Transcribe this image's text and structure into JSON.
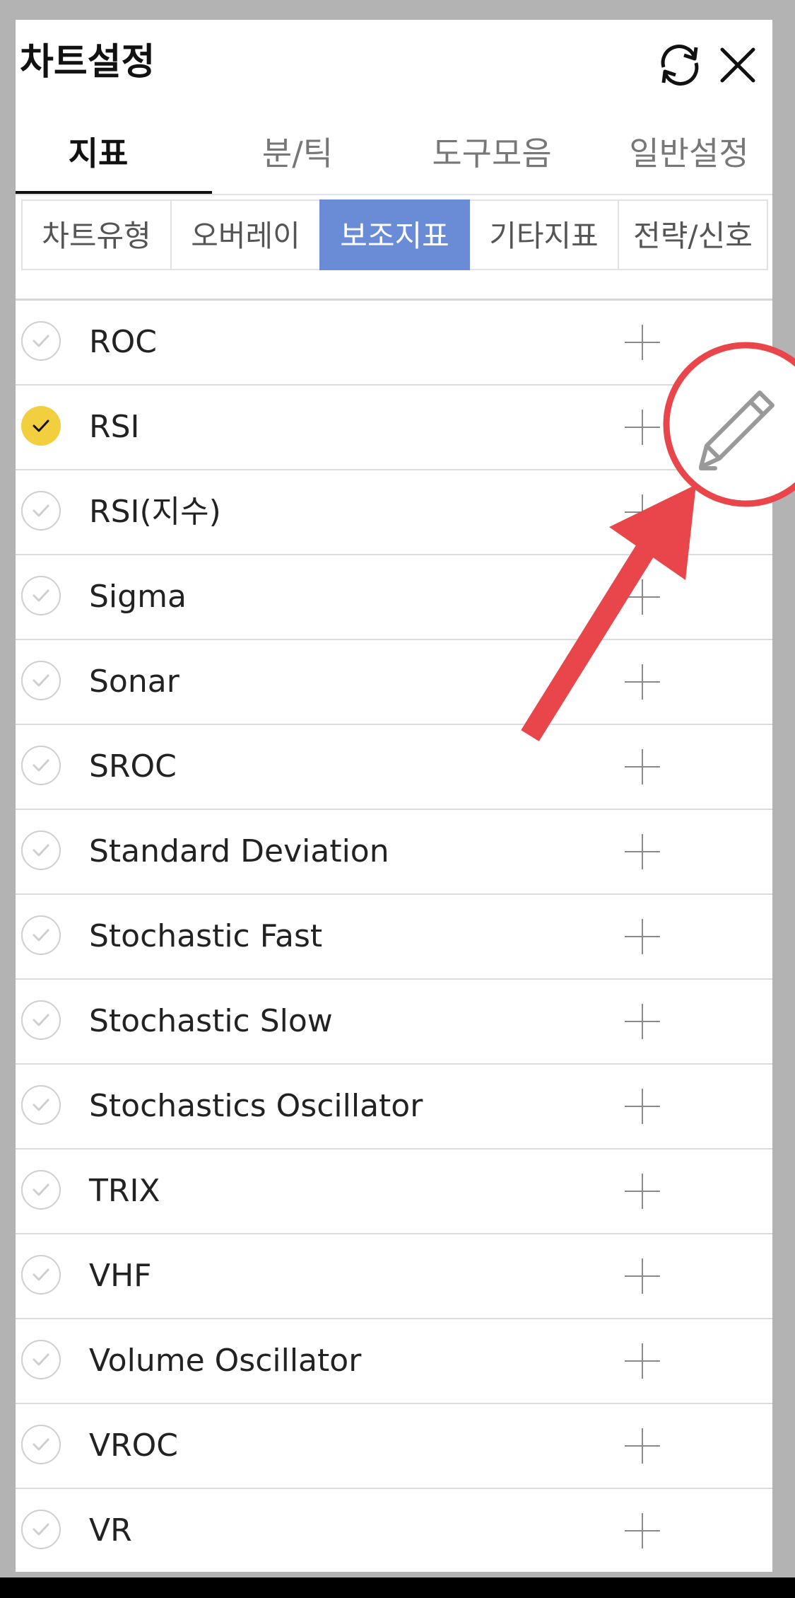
{
  "header": {
    "title": "차트설정",
    "refresh_icon": "refresh-icon",
    "close_icon": "close-icon"
  },
  "main_tabs": [
    {
      "label": "지표",
      "active": true
    },
    {
      "label": "분/틱",
      "active": false
    },
    {
      "label": "도구모음",
      "active": false
    },
    {
      "label": "일반설정",
      "active": false
    }
  ],
  "sub_tabs": [
    {
      "label": "차트유형",
      "active": false
    },
    {
      "label": "오버레이",
      "active": false
    },
    {
      "label": "보조지표",
      "active": true
    },
    {
      "label": "기타지표",
      "active": false
    },
    {
      "label": "전략/신호",
      "active": false
    }
  ],
  "indicators": [
    {
      "label": "ROC",
      "checked": false
    },
    {
      "label": "RSI",
      "checked": true
    },
    {
      "label": "RSI(지수)",
      "checked": false
    },
    {
      "label": "Sigma",
      "checked": false
    },
    {
      "label": "Sonar",
      "checked": false
    },
    {
      "label": "SROC",
      "checked": false
    },
    {
      "label": "Standard Deviation",
      "checked": false
    },
    {
      "label": "Stochastic Fast",
      "checked": false
    },
    {
      "label": "Stochastic Slow",
      "checked": false
    },
    {
      "label": "Stochastics Oscillator",
      "checked": false
    },
    {
      "label": "TRIX",
      "checked": false
    },
    {
      "label": "VHF",
      "checked": false
    },
    {
      "label": "Volume Oscillator",
      "checked": false
    },
    {
      "label": "VROC",
      "checked": false
    },
    {
      "label": "VR",
      "checked": false
    }
  ],
  "colors": {
    "accent_blue": "#6a8bd6",
    "check_yellow": "#f2cf3e",
    "annotation_red": "#e8464b"
  },
  "annotation": {
    "circle_icon": "pencil-icon",
    "arrow": "arrow-annotation"
  }
}
